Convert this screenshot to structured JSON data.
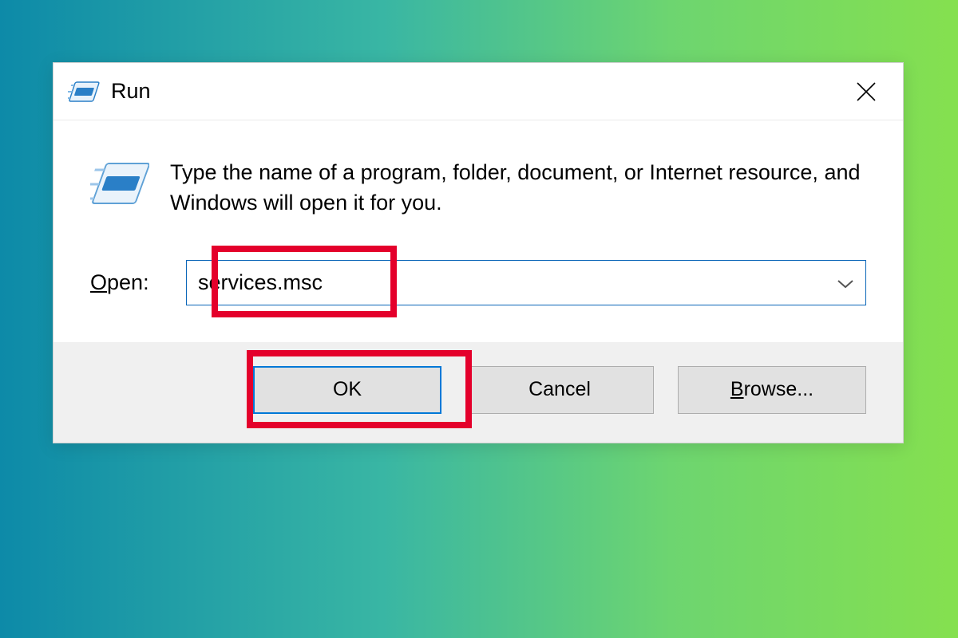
{
  "dialog": {
    "title": "Run",
    "description": "Type the name of a program, folder, document, or Internet resource, and Windows will open it for you.",
    "open_label_pre": "O",
    "open_label_post": "pen:",
    "input_value": "services.msc",
    "buttons": {
      "ok": "OK",
      "cancel": "Cancel",
      "browse_pre": "B",
      "browse_post": "rowse..."
    }
  }
}
